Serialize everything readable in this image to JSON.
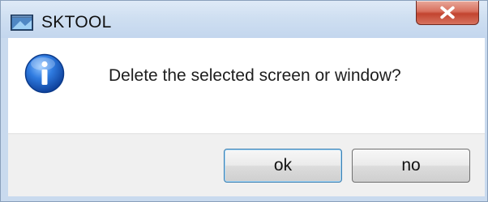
{
  "window": {
    "title": "SKTOOL",
    "title_icon": "app-window-icon",
    "close_icon": "close-icon"
  },
  "dialog": {
    "icon": "info-icon",
    "message": "Delete the selected screen or window?"
  },
  "buttons": {
    "ok_label": "ok",
    "no_label": "no"
  },
  "colors": {
    "titlebar": "#cfdff1",
    "close_button": "#c24430",
    "info_blue": "#1d5fbf",
    "footer": "#f0f0f0"
  }
}
